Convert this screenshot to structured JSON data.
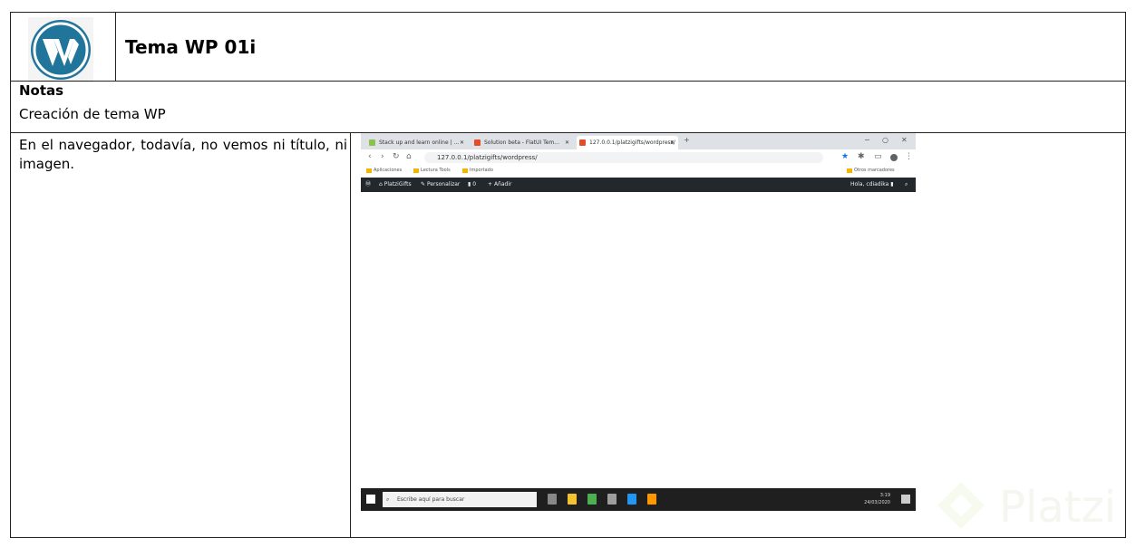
{
  "header": {
    "title": "Tema WP 01i"
  },
  "notas": {
    "label": "Notas",
    "text": "Creación de tema WP"
  },
  "description": "En el navegador, todavía, no vemos ni título, ni imagen.",
  "browser": {
    "tabs": [
      {
        "label": "Stack up and learn online | ... ",
        "favicon_color": "#8bc34a"
      },
      {
        "label": "Solution beta - FlatUI Tem...",
        "favicon_color": "#e44d26"
      },
      {
        "label": "127.0.0.1/platzigifts/wordpress/",
        "favicon_color": "#e44d26"
      }
    ],
    "new_tab": "+",
    "window_controls": [
      "−",
      "○",
      "✕"
    ],
    "url": "127.0.0.1/platzigifts/wordpress/",
    "bookmarks": [
      "Aplicaciones",
      "Lectura Tools",
      "Importado"
    ],
    "other_bookmarks": "Otros marcadores",
    "admin_bar": {
      "site_name": "PlatziGifts",
      "customize": "Personalizar",
      "comments": "0",
      "new": "Añadir",
      "greeting": "Hola, cdiadika"
    },
    "taskbar": {
      "search_placeholder": "Escribe aquí para buscar",
      "time": "3:19",
      "date": "24/03/2020"
    }
  },
  "watermark": {
    "brand": "Platzi"
  },
  "colors": {
    "wp_blue": "#21759b",
    "admin_bar": "#23282d",
    "platzi_green": "#98ca3f"
  }
}
